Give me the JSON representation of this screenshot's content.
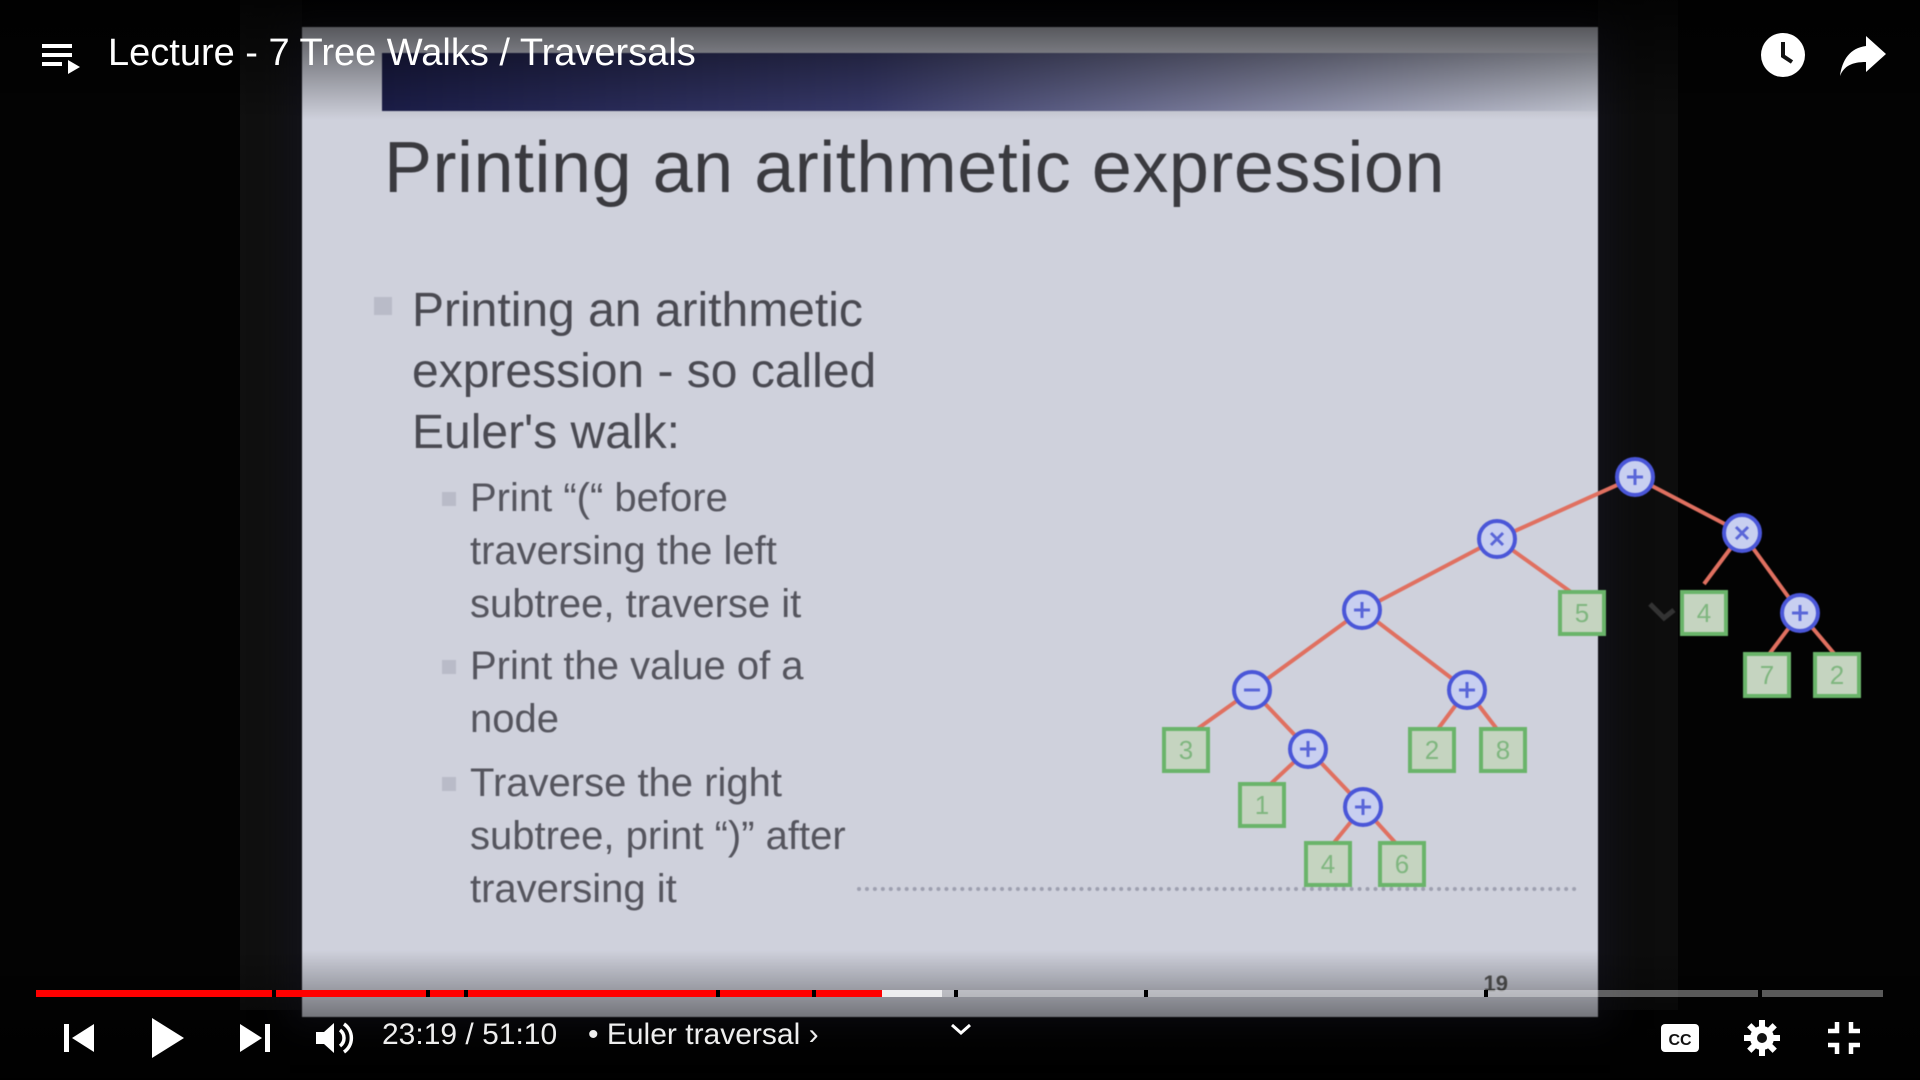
{
  "player": {
    "title": "Lecture - 7 Tree Walks / Traversals",
    "time_current": "23:19",
    "time_separator": " / ",
    "time_total": "51:10",
    "chapter_prefix": "•",
    "chapter_label": "Euler traversal",
    "chapter_arrow": "›",
    "progress_fraction": 0.456,
    "buffered_fraction": 0.49,
    "accent_color": "#ff0000",
    "icons": [
      "playlist-icon",
      "clock-icon",
      "share-icon",
      "skip-previous-icon",
      "play-icon",
      "skip-next-icon",
      "volume-icon",
      "chevron-down-icon",
      "captions-icon",
      "settings-icon",
      "exit-fullscreen-icon"
    ]
  },
  "slide": {
    "title": "Printing an arithmetic expression",
    "bullet_lines": [
      "Printing an arithmetic",
      "expression -  so called",
      "Euler's walk:"
    ],
    "sub_bullets": [
      [
        "Print “(“ before",
        "traversing the left",
        "subtree, traverse it"
      ],
      [
        "Print the value of a",
        "node"
      ],
      [
        "Traverse the right",
        "subtree, print “)” after",
        "traversing it"
      ]
    ],
    "page_number": "19",
    "tree_leaves": [
      "3",
      "1",
      "4",
      "6",
      "2",
      "8",
      "5",
      "4",
      "7",
      "2"
    ]
  }
}
